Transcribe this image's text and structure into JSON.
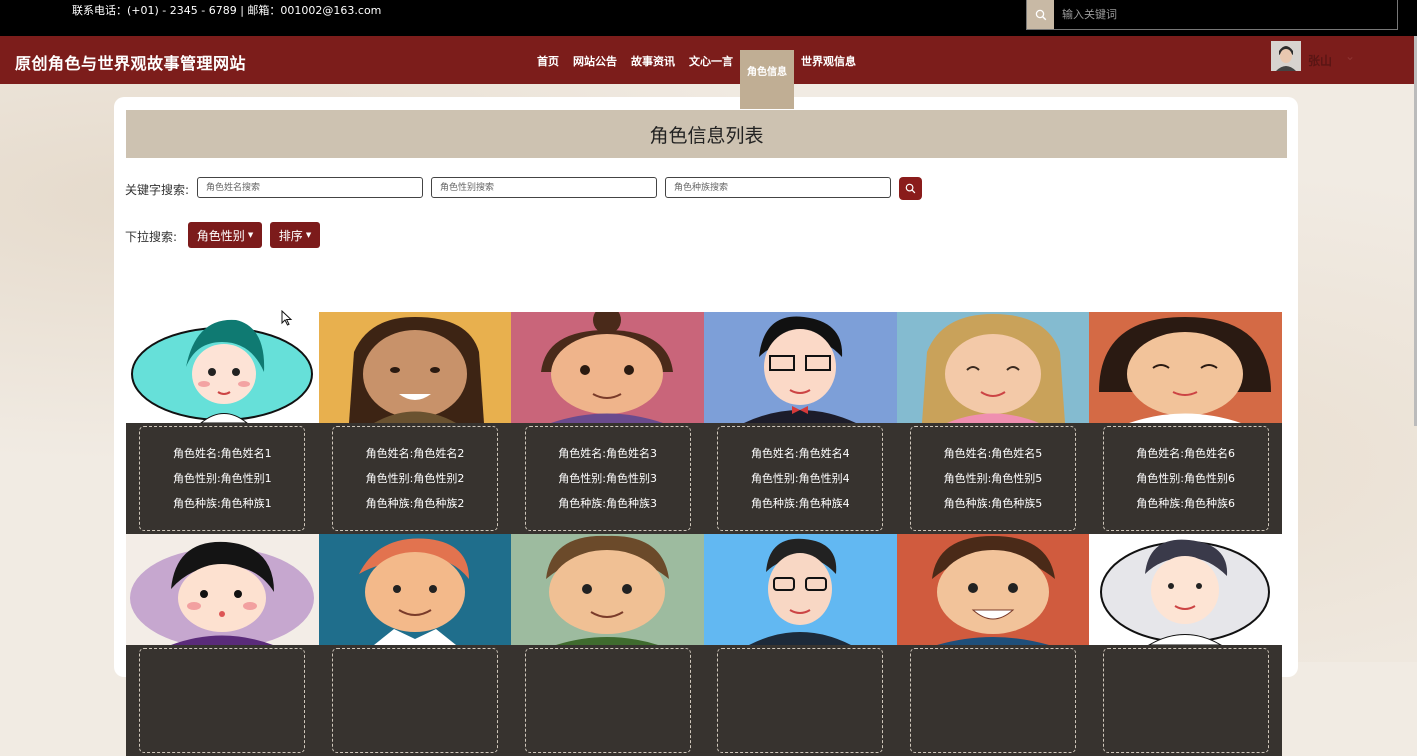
{
  "topbar": {
    "contact": "联系电话：(+01) - 2345 - 6789 | 邮箱：001002@163.com",
    "search_placeholder": "输入关键词",
    "search_icon": "search-icon"
  },
  "navbar": {
    "site_title": "原创角色与世界观故事管理网站",
    "items": [
      {
        "label": "首页"
      },
      {
        "label": "网站公告"
      },
      {
        "label": "故事资讯"
      },
      {
        "label": "文心一言"
      },
      {
        "label": "角色信息",
        "active": true
      },
      {
        "label": "世界观信息"
      }
    ],
    "username": "张山",
    "accent_color": "#7c1d1b",
    "active_color": "#c0ae94"
  },
  "page": {
    "title": "角色信息列表",
    "keyword_label": "关键字搜索:",
    "name_placeholder": "角色姓名搜索",
    "gender_placeholder": "角色性别搜索",
    "race_placeholder": "角色种族搜索",
    "dropdown_label": "下拉搜索:",
    "gender_dropdown": "角色性别",
    "sort_dropdown": "排序"
  },
  "characters": [
    {
      "name": "角色姓名:角色姓名1",
      "gender": "角色性别:角色性别1",
      "race": "角色种族:角色种族1",
      "bg": "#ffffff"
    },
    {
      "name": "角色姓名:角色姓名2",
      "gender": "角色性别:角色性别2",
      "race": "角色种族:角色种族2",
      "bg": "#e8b04e"
    },
    {
      "name": "角色姓名:角色姓名3",
      "gender": "角色性别:角色性别3",
      "race": "角色种族:角色种族3",
      "bg": "#c9657a"
    },
    {
      "name": "角色姓名:角色姓名4",
      "gender": "角色性别:角色性别4",
      "race": "角色种族:角色种族4",
      "bg": "#7d9fd8"
    },
    {
      "name": "角色姓名:角色姓名5",
      "gender": "角色性别:角色性别5",
      "race": "角色种族:角色种族5",
      "bg": "#84bbd0"
    },
    {
      "name": "角色姓名:角色姓名6",
      "gender": "角色性别:角色性别6",
      "race": "角色种族:角色种族6",
      "bg": "#d46a45"
    },
    {
      "name": "",
      "gender": "",
      "race": "",
      "bg": "#c6a7cf"
    },
    {
      "name": "",
      "gender": "",
      "race": "",
      "bg": "#1f6e8c"
    },
    {
      "name": "",
      "gender": "",
      "race": "",
      "bg": "#9dbb9f"
    },
    {
      "name": "",
      "gender": "",
      "race": "",
      "bg": "#62b8f2"
    },
    {
      "name": "",
      "gender": "",
      "race": "",
      "bg": "#d05b3e"
    },
    {
      "name": "",
      "gender": "",
      "race": "",
      "bg": "#ffffff"
    }
  ]
}
